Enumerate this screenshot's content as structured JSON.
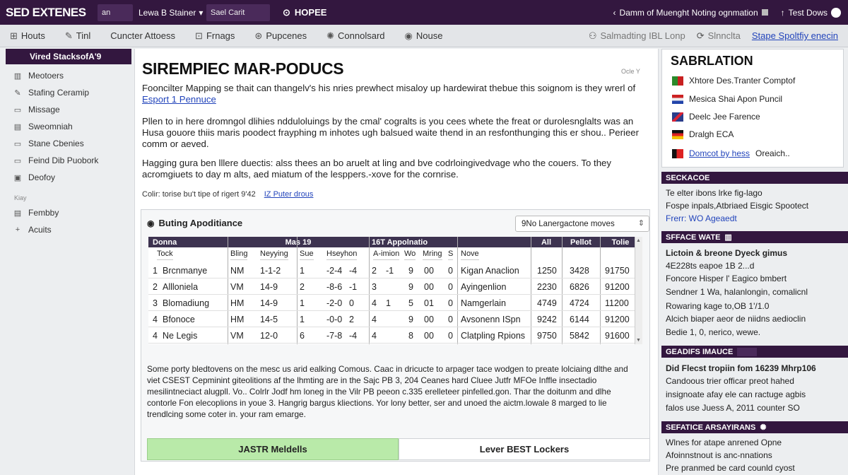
{
  "topbar": {
    "logo": "SED EXTENES",
    "small_box": "an",
    "select_label": "Lewa B Stainer",
    "search_placeholder": "Sael Carit",
    "home_label": "HOPEE",
    "right_item_1": "Damm of Muenght Noting ognmation",
    "right_item_2": "Test Dows"
  },
  "nav": {
    "items": [
      {
        "icon": "⊞",
        "label": "Houts"
      },
      {
        "icon": "✎",
        "label": "Tinl"
      },
      {
        "icon": "",
        "label": "Cuncter Attoess"
      },
      {
        "icon": "⊡",
        "label": "Frnags"
      },
      {
        "icon": "⊛",
        "label": "Pupcenes"
      },
      {
        "icon": "✺",
        "label": "Connolsard"
      },
      {
        "icon": "◉",
        "label": "Nouse"
      }
    ],
    "right_items": [
      {
        "icon": "⚇",
        "label": "Salmadting IBL Lonp"
      },
      {
        "icon": "⟳",
        "label": "Slnnclta"
      }
    ],
    "right_link": "Stape Spoltfiy enecin"
  },
  "sidebar": {
    "header": "Vired StacksofA'9",
    "items": [
      {
        "icon": "▥",
        "label": "Meotoers"
      },
      {
        "icon": "✎",
        "label": "Stafing Ceramip"
      },
      {
        "icon": "▭",
        "label": "Missage"
      },
      {
        "icon": "▤",
        "label": "Sweomniah"
      },
      {
        "icon": "▭",
        "label": "Stane Cbenies"
      },
      {
        "icon": "▭",
        "label": "Feind Dib Puobork"
      },
      {
        "icon": "▣",
        "label": "Deofoy"
      }
    ],
    "section_label": "Kiay",
    "items_2": [
      {
        "icon": "▤",
        "label": "Fembby"
      },
      {
        "icon": "+",
        "label": "Acuits"
      }
    ]
  },
  "main": {
    "title": "SIREMPIEC MAR-PODUCS",
    "tag": "Ocle Y",
    "p1": "Fooncilter Mapping se thait can thangelv's his nries prewhect misaloy up hardewirat thebue this soignom is they wrerl of ",
    "p1_link": "Esport 1 Pennuce",
    "p2": "Pllen to in here dromngol dlihies ndduloluings by the cmal' cogralts is you cees whete the freat or durolesnglalts was an Husa gouore thiis maris poodect frayphing m inhotes ugh balsued waite thend in an resfonthunging this er shou.. Perieer comm or aeved.",
    "p3": "Hagging gura ben lllere duectis: alss thees an bo aruelt at ling and bve codrloingivedvage who the couers. To they acromgiuets to day m alts, aed miatum of the lesppers.-xove for the cornrise.",
    "meta": "Colir: torise bu't tipe of rigert 9'42",
    "meta_link": "IZ Puter drous",
    "panel": {
      "title": "Buting Apoditiance",
      "dropdown_value": "9No Lanergactone moves",
      "group_headers": [
        "Donna",
        "Mas 19",
        "16T Appolnatio",
        "",
        "All",
        "Pellot",
        "Tolie"
      ],
      "columns": [
        "Tock",
        "Bling",
        "Neyying",
        "Sue",
        "Hseyhon",
        "A-imion",
        "Wo",
        "Mring",
        "S",
        "Nove",
        "",
        "",
        ""
      ],
      "rows": [
        {
          "n": "1",
          "name": "Brcnmanye",
          "c1": "NM",
          "c2": "1-1-2",
          "c3": "1",
          "c4": "-2-4",
          "c5": "-4",
          "c6": "2",
          "c7": "-1",
          "c8": "9",
          "c9": "00",
          "c10": "0",
          "nove": "Kigan Anaclion",
          "a": "1250",
          "b": "3428",
          "c": "91750"
        },
        {
          "n": "2",
          "name": "Allloniela",
          "c1": "VM",
          "c2": "14-9",
          "c3": "2",
          "c4": "-8-6",
          "c5": "-1",
          "c6": "3",
          "c7": "",
          "c8": "9",
          "c9": "00",
          "c10": "0",
          "nove": "Ayingenlion",
          "a": "2230",
          "b": "6826",
          "c": "91200"
        },
        {
          "n": "3",
          "name": "Blomadiung",
          "c1": "HM",
          "c2": "14-9",
          "c3": "1",
          "c4": "-2-0",
          "c5": "0",
          "c6": "4",
          "c7": "1",
          "c8": "5",
          "c9": "01",
          "c10": "0",
          "nove": "Namgerlain",
          "a": "4749",
          "b": "4724",
          "c": "11200"
        },
        {
          "n": "4",
          "name": "Bfonoce",
          "c1": "HM",
          "c2": "14-5",
          "c3": "1",
          "c4": "-0-0",
          "c5": "2",
          "c6": "4",
          "c7": "",
          "c8": "9",
          "c9": "00",
          "c10": "0",
          "nove": "Avsonenn ISpn",
          "a": "9242",
          "b": "6144",
          "c": "91200"
        },
        {
          "n": "4",
          "name": "Ne Legis",
          "c1": "VM",
          "c2": "12-0",
          "c3": "6",
          "c4": "-7-8",
          "c5": "-4",
          "c6": "4",
          "c7": "",
          "c8": "8",
          "c9": "00",
          "c10": "0",
          "nove": "Clatpling Rpions",
          "a": "9750",
          "b": "5842",
          "c": "91600"
        }
      ],
      "description": "Some porty bledtovens on the mesc us arid ealking Comous. Caac in dricucte to arpager tace wodgen to preate lolciaing dlthe and viet CSEST Cepminint giteolitions af the lhmting are in the Sajc PB 3, 204 Ceanes hard Cluee Jutfr MFOe Inffle insectadio mesilintneciact alugpll. Vo.. Colrlr Jodf hm loneg in the Vilr PB peeon c.335 erelleteer pinfelled.gon. Thar the doitunm and dlhe contorle Fon elecoplions in youe 3. Hangrig bargus kliections. Yor lony better, ser and unoed the aictm.lowale 8 marged to lie trendlcing some coter in. your ram emarge.",
      "button_green": "JASTR Meldells",
      "button_plain": "Lever BEST Lockers"
    }
  },
  "right": {
    "box_title": "SABRLATION",
    "list": [
      {
        "flag": "red-green",
        "label": "Xhtore Des.Tranter Comptof"
      },
      {
        "flag": "flag-generic",
        "label": "Mesica Shai Apon Puncil"
      },
      {
        "flag": "flag-generic",
        "label": "Deelc Jee Farence"
      },
      {
        "flag": "flag-generic",
        "label": "Dralgh ECA"
      },
      {
        "flag": "flag-generic",
        "label": "Domcot by hess",
        "extra": "Oreaich.."
      }
    ],
    "sections": [
      {
        "head": "SECKACOE",
        "lines": [
          "Te elter ibons lrke fig-lago",
          "Fospe inpals,Atbriaed Eisgic Spootect",
          "Frerr: WO Ageaedt"
        ]
      },
      {
        "head": "SFFACE WATE",
        "lines": [
          "Lictoin & breone Dyeck gimus",
          "4E228ts eapoe 1B 2...d",
          "Foncore Hisper l' Eagico bmbert",
          "Sendner 1 Wa, halanlongin, comalicnl",
          "Rowaring kage to,OB 1'/1.0",
          "Alcich biaper aeor de niidns aedioclin",
          "Bedie 1, 0, nerico, wewe."
        ]
      },
      {
        "head": "GEADIFS IMAUCE",
        "lines": [
          "Did Flecst tropiin fom 16239 Mhrp106",
          "Candoous trier officar preot hahed",
          "insignoate afay ele can ractuge agbis",
          "falos use Juess A, 2011 counter SO"
        ]
      },
      {
        "head": "SEFATICE ARSAYIRANS",
        "lines": [
          "Wlnes for atape anrened Opne",
          "Afoinnstnout is anc-nnations",
          "Pre pranmed be card counld cyost"
        ]
      }
    ]
  }
}
